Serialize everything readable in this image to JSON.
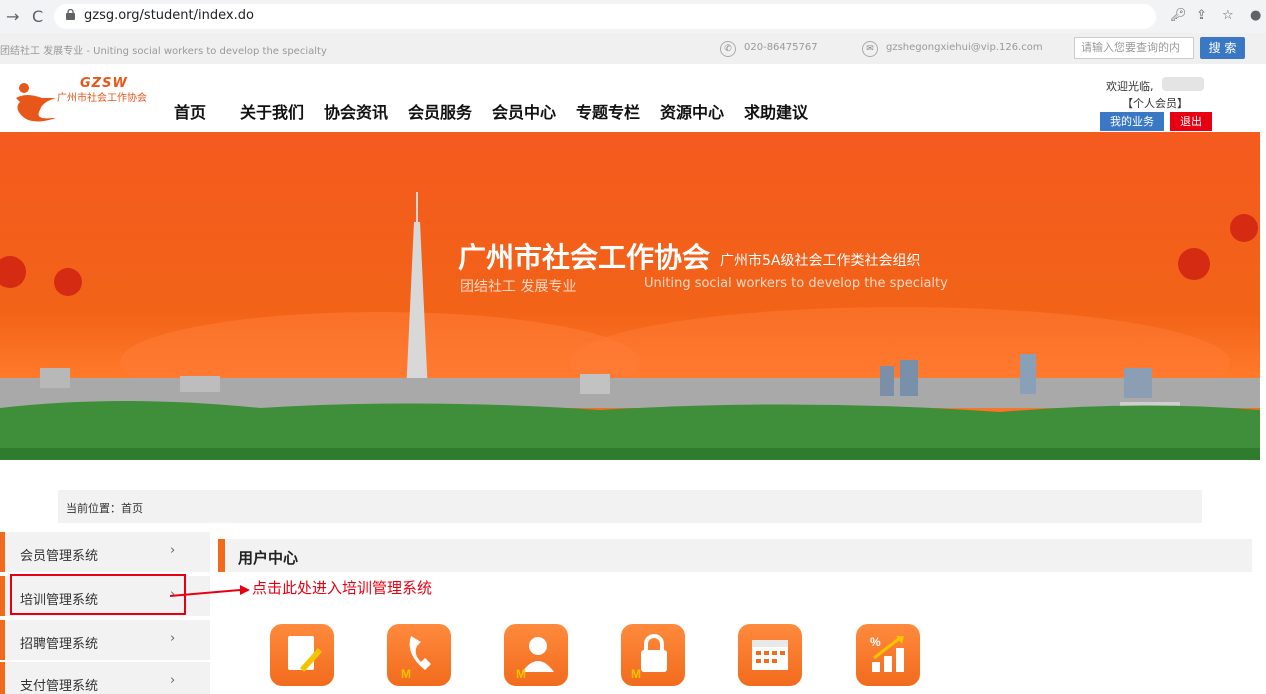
{
  "browser": {
    "url": "gzsg.org/student/index.do"
  },
  "topbar": {
    "slogan": "团结社工 发展专业 - Uniting social workers to develop the specialty",
    "phone": "020-86475767",
    "email": "gzshegongxiehui@vip.126.com",
    "search_placeholder": "请输入您要查询的内",
    "search_label": "搜 索"
  },
  "header": {
    "logo_abbr": "GZSW",
    "logo_name": "广州市社会工作协会",
    "menu": [
      "首页",
      "关于我们",
      "协会资讯",
      "会员服务",
      "会员中心",
      "专题专栏",
      "资源中心",
      "求助建议"
    ],
    "welcome": "欢迎光临,",
    "member_type": "【个人会员】",
    "my_business": "我的业务",
    "logout": "退出"
  },
  "banner": {
    "title": "广州市社会工作协会",
    "subtitle": "广州市5A级社会工作类社会组织",
    "slogan_cn": "团结社工 发展专业",
    "slogan_en": "Uniting social workers to develop the specialty"
  },
  "breadcrumb": "当前位置：首页",
  "sidebar": {
    "items": [
      "会员管理系统",
      "培训管理系统",
      "招聘管理系统",
      "支付管理系统"
    ]
  },
  "annotation": "点击此处进入培训管理系统",
  "user_center": {
    "title": "用户中心",
    "tiles": [
      "notebook-icon",
      "phone-icon",
      "person-icon",
      "lock-icon",
      "calendar-icon",
      "growth-icon"
    ]
  },
  "colors": {
    "accent": "#f26b1d",
    "blue": "#3a78c3",
    "red": "#e60012"
  }
}
